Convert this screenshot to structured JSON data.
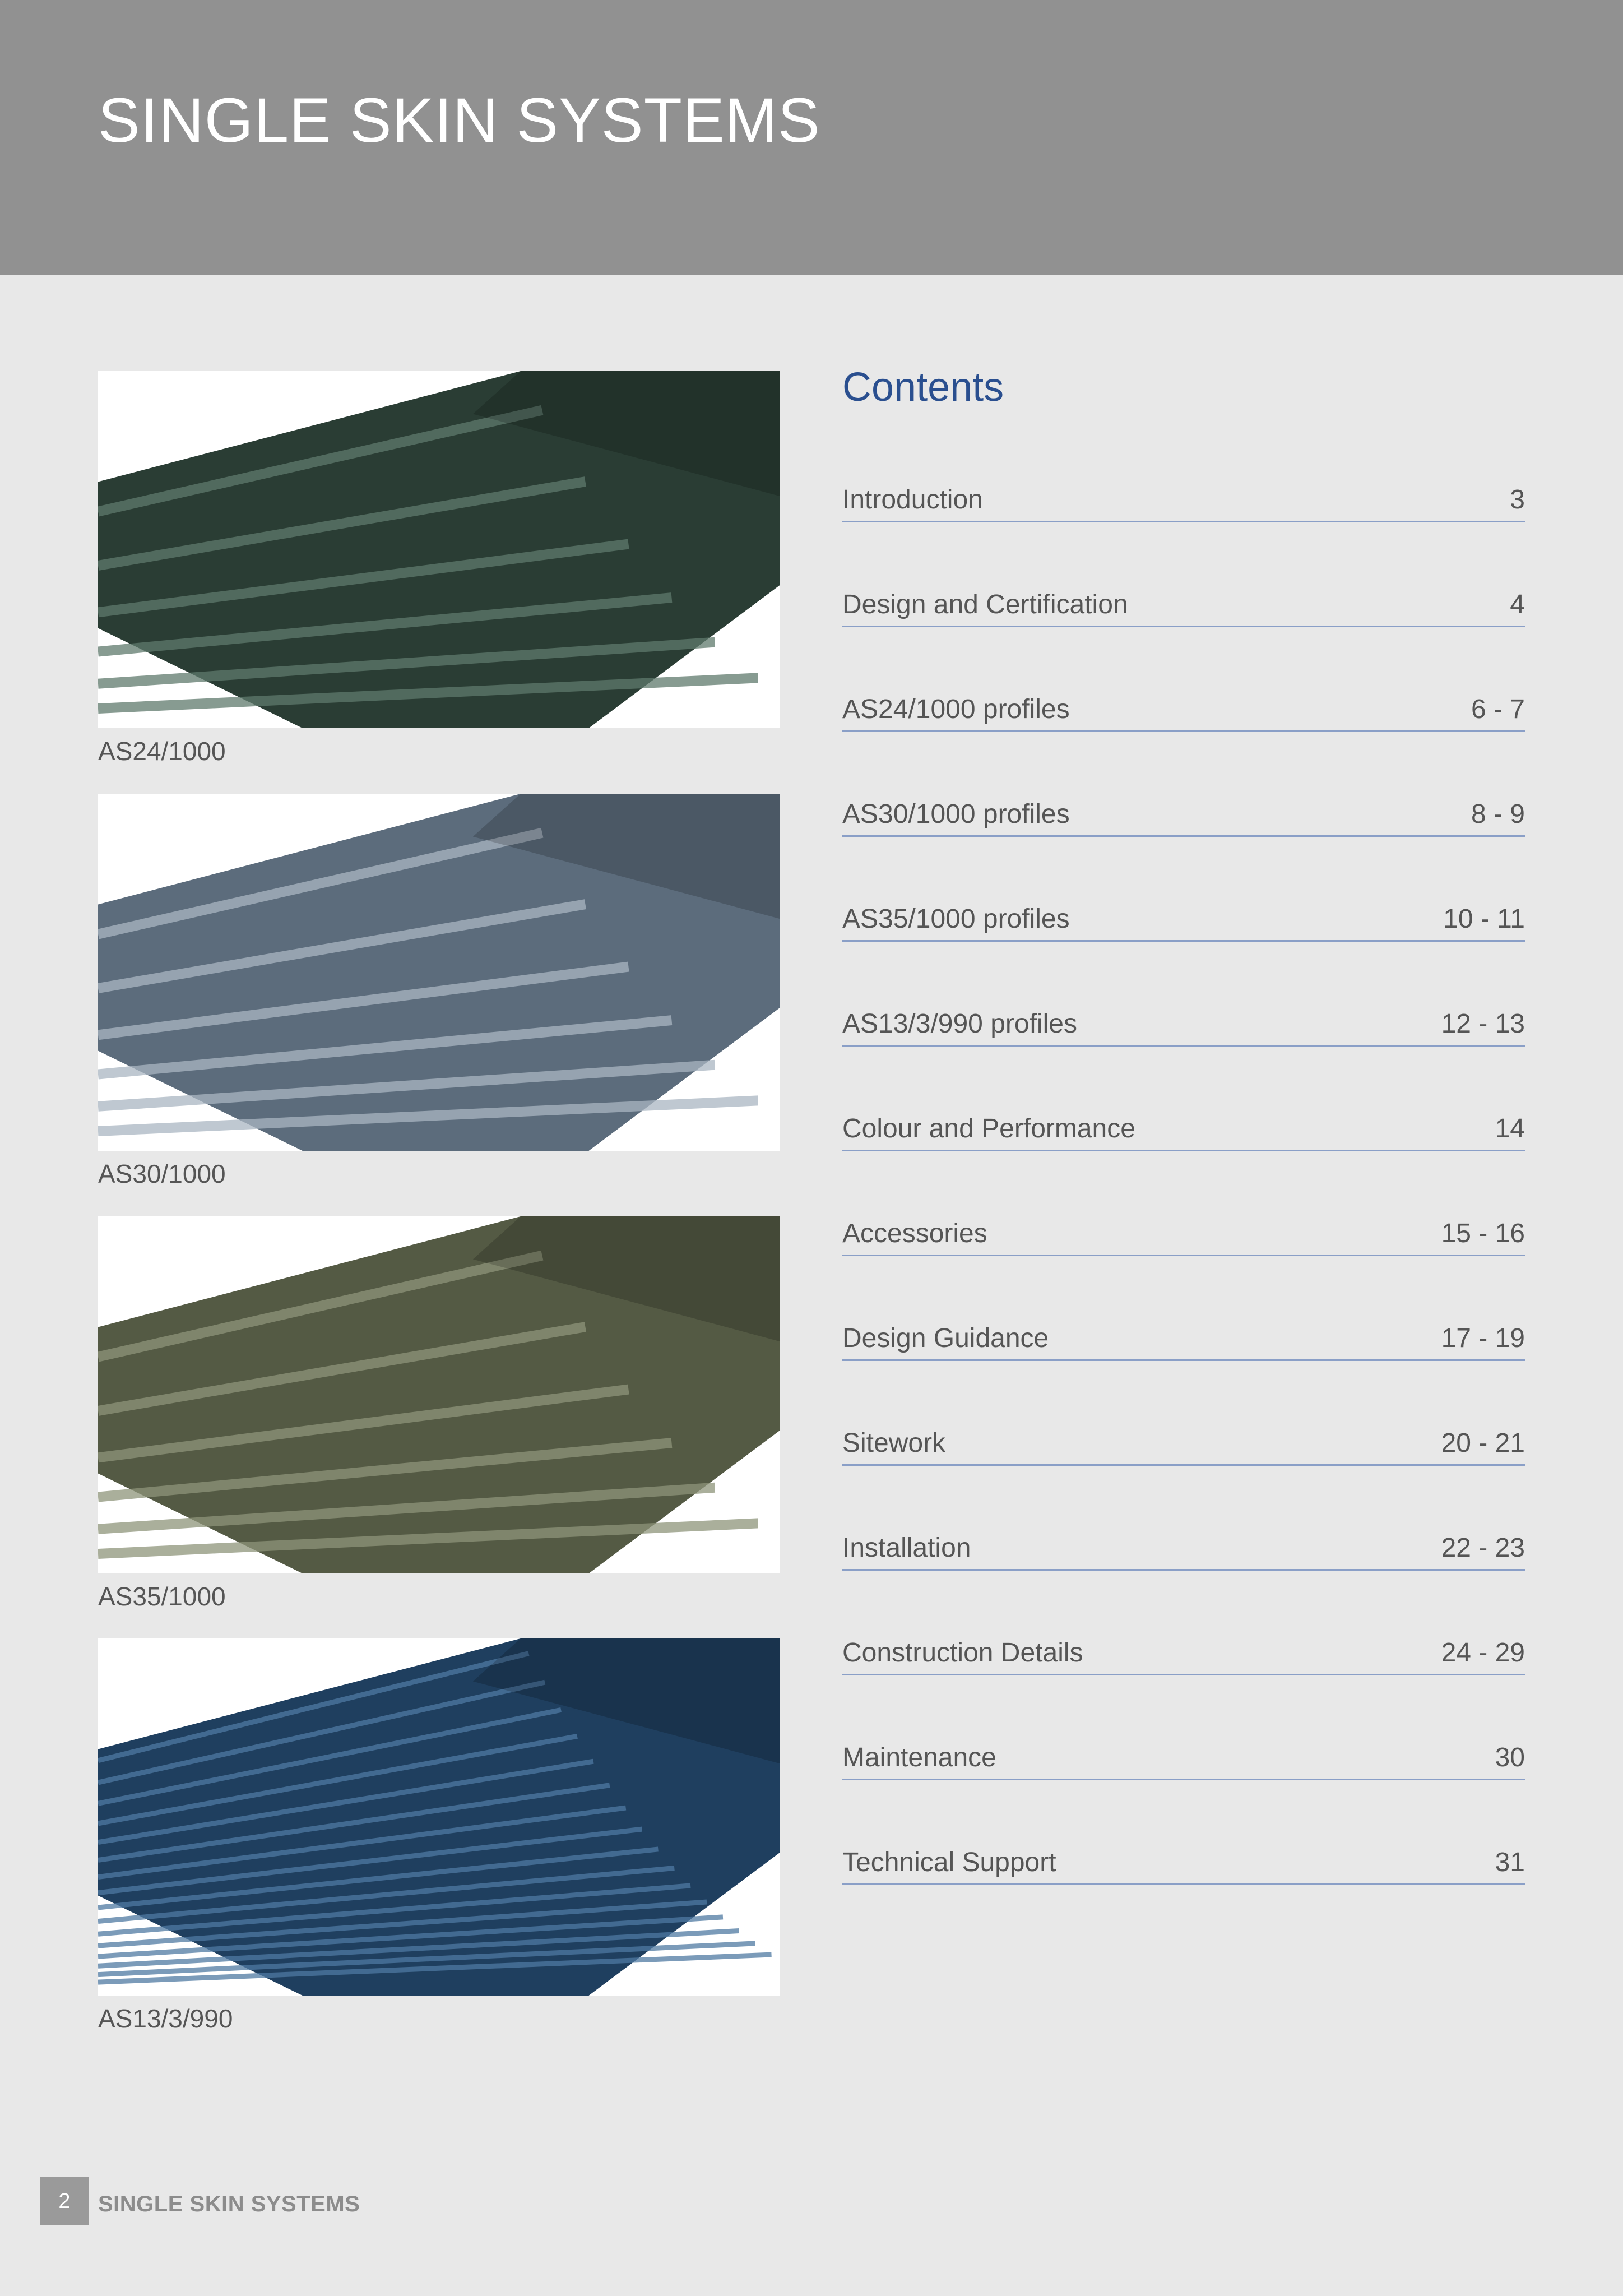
{
  "header": {
    "title": "SINGLE SKIN SYSTEMS"
  },
  "products": [
    {
      "caption": "AS24/1000",
      "color_dark": "#2a3d34",
      "color_light": "#5f7a6c"
    },
    {
      "caption": "AS30/1000",
      "color_dark": "#5c6c7c",
      "color_light": "#a9b6c2"
    },
    {
      "caption": "AS35/1000",
      "color_dark": "#545a44",
      "color_light": "#8d947a"
    },
    {
      "caption": "AS13/3/990",
      "color_dark": "#1f3f5f",
      "color_light": "#4f7aa1"
    }
  ],
  "contents": {
    "title": "Contents",
    "items": [
      {
        "title": "Introduction",
        "pages": "3"
      },
      {
        "title": "Design and Certification",
        "pages": "4"
      },
      {
        "title": "AS24/1000 profiles",
        "pages": "6 - 7"
      },
      {
        "title": "AS30/1000 profiles",
        "pages": "8 - 9"
      },
      {
        "title": "AS35/1000 profiles",
        "pages": "10 - 11"
      },
      {
        "title": "AS13/3/990 profiles",
        "pages": "12 - 13"
      },
      {
        "title": "Colour and Performance",
        "pages": "14"
      },
      {
        "title": "Accessories",
        "pages": "15 - 16"
      },
      {
        "title": "Design Guidance",
        "pages": "17 - 19"
      },
      {
        "title": "Sitework",
        "pages": "20 - 21"
      },
      {
        "title": "Installation",
        "pages": "22 - 23"
      },
      {
        "title": "Construction Details",
        "pages": "24 - 29"
      },
      {
        "title": "Maintenance",
        "pages": "30"
      },
      {
        "title": "Technical Support",
        "pages": "31"
      }
    ]
  },
  "footer": {
    "page_number": "2",
    "label": "SINGLE SKIN SYSTEMS"
  },
  "colors": {
    "header_band": "#919191",
    "accent_blue": "#2a4f8f",
    "rule_blue": "#8a9fc7"
  }
}
